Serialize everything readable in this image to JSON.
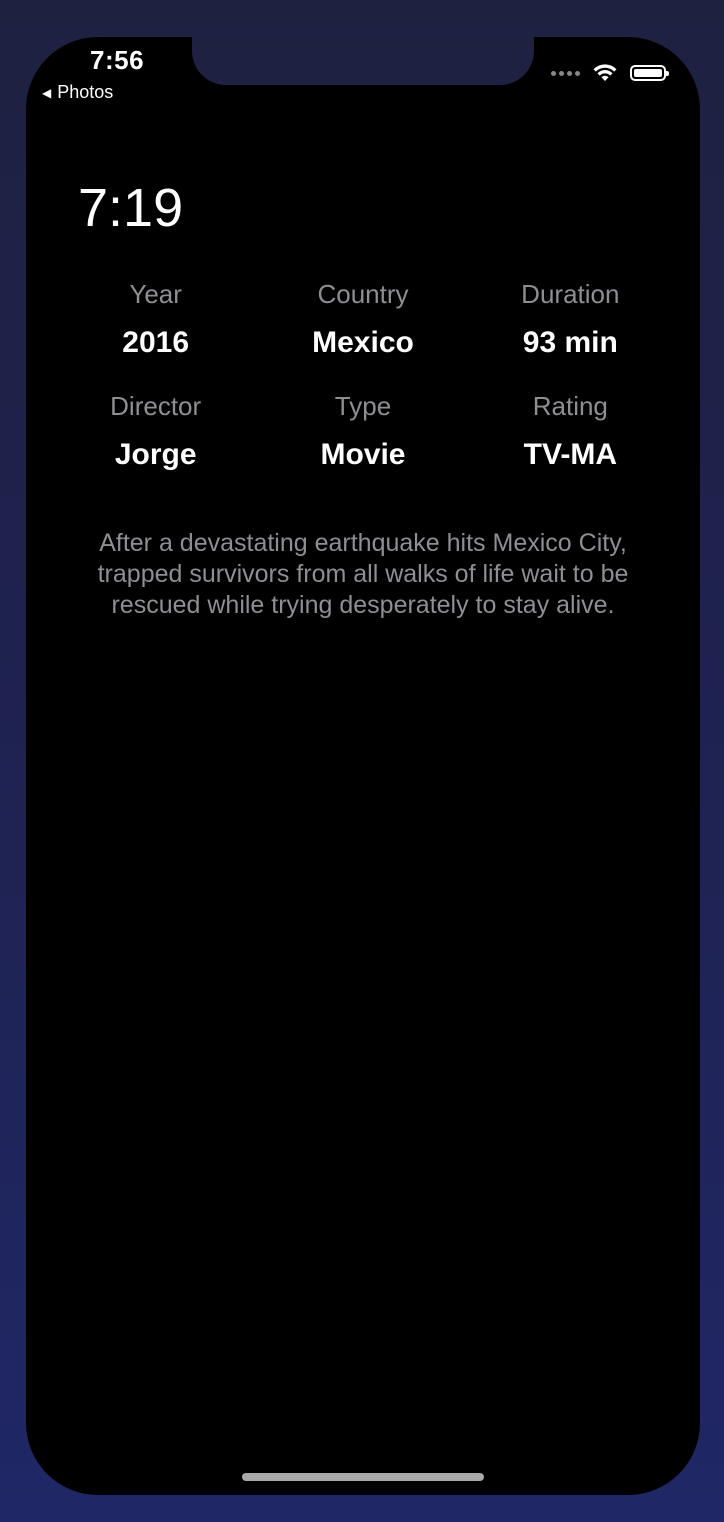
{
  "status_bar": {
    "time": "7:56",
    "back_label": "Photos"
  },
  "page": {
    "title": "7:19"
  },
  "details": [
    {
      "label": "Year",
      "value": "2016"
    },
    {
      "label": "Country",
      "value": "Mexico"
    },
    {
      "label": "Duration",
      "value": "93 min"
    },
    {
      "label": "Director",
      "value": "Jorge"
    },
    {
      "label": "Type",
      "value": "Movie"
    },
    {
      "label": "Rating",
      "value": "TV-MA"
    }
  ],
  "description": "After a devastating earthquake hits Mexico City, trapped survivors from all walks of life wait to be rescued while trying desperately to stay alive.",
  "icons": {
    "signal": "cellular-signal-icon",
    "wifi": "wifi-icon",
    "battery": "battery-icon",
    "back": "back-arrow-icon"
  },
  "colors": {
    "background": "#000000",
    "label": "#8e8e93",
    "value": "#ffffff"
  }
}
